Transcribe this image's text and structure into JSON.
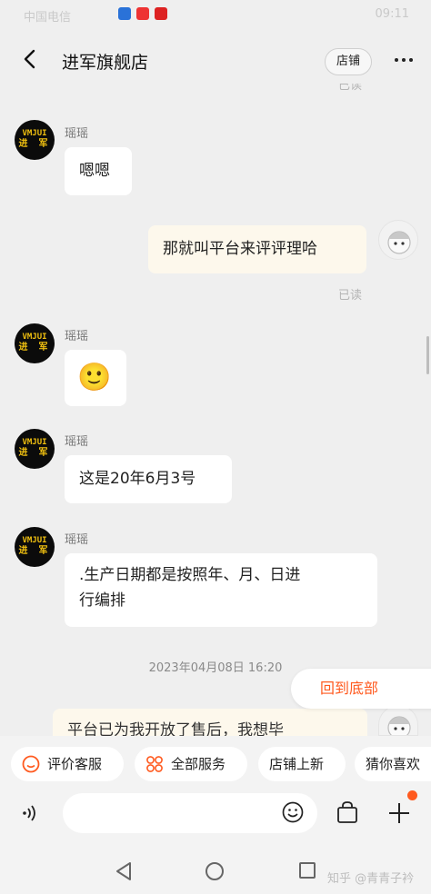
{
  "status_bar": {
    "carrier": "中国电信",
    "right": "09:11"
  },
  "header": {
    "title": "进军旗舰店",
    "shop_label": "店铺"
  },
  "read_label": "已读",
  "avatar_text": {
    "line1": "VMJUI",
    "line2": "进 军"
  },
  "messages": [
    {
      "name": "瑶瑶",
      "text": "嗯嗯"
    },
    {
      "text": "那就叫平台来评评理哈"
    },
    {
      "name": "瑶瑶",
      "text": "🙂"
    },
    {
      "name": "瑶瑶",
      "text": "这是20年6月3号"
    },
    {
      "name": "瑶瑶",
      "line1": ".生产日期都是按照年、月、日进",
      "line2": "行编排"
    },
    {
      "text": "平台已为我开放了售后，我想毕"
    }
  ],
  "timestamp": "2023年04月08日 16:20",
  "jump_bottom": "回到底部",
  "quick_actions": [
    "评价客服",
    "全部服务",
    "店铺上新",
    "猜你喜欢"
  ],
  "watermark": "知乎 @青青子衿",
  "colors": {
    "accent": "#ff5a1f",
    "my_bubble": "#fdf8ec",
    "background": "#efefef"
  },
  "icons": {
    "back": "chevron-left-icon",
    "more": "more-dots-icon",
    "voice": "voice-icon",
    "emoji": "emoji-icon",
    "bag": "shopping-bag-icon",
    "plus": "plus-icon"
  }
}
